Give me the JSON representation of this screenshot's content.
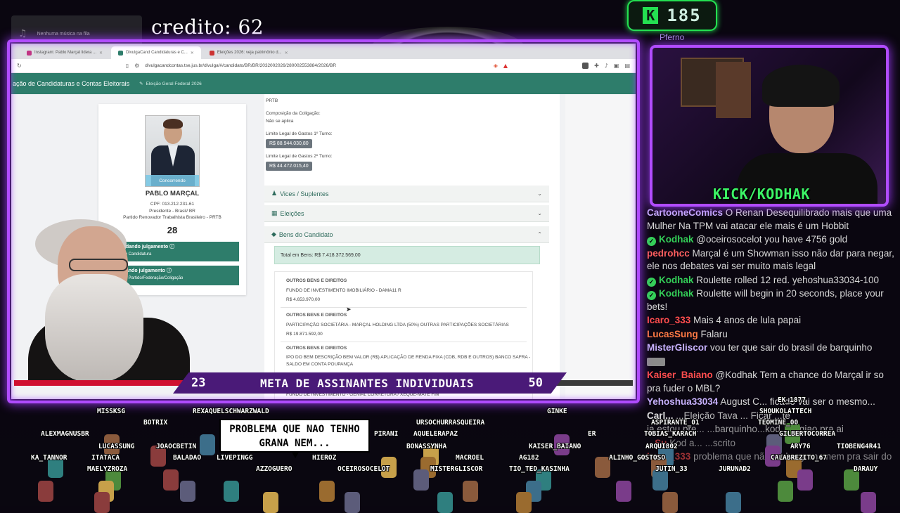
{
  "overlay": {
    "music_widget": "Nenhuma música na fila",
    "credit": "credito: 62",
    "kick_letter": "K",
    "kick_count": "185",
    "pfreno": "Pferno"
  },
  "browser": {
    "tabs": [
      {
        "label": "Instagram: Pablo Marçal lidera ..."
      },
      {
        "label": "DivulgaCand Candidaturas e C..."
      },
      {
        "label": "Eleições 2026: veja patrimônio d..."
      }
    ],
    "url": "divulgacandcontas.tse.jus.br/divulga/#/candidato/BR/BR/2032002026/280002553884/2026/BR",
    "site_title": "ação de Candidaturas e Contas Eleitorais",
    "site_subtitle": "Eleição Geral Federal 2026"
  },
  "candidate": {
    "status_badge": "Concorrendo",
    "name": "PABLO MARÇAL",
    "cpf": "CPF: 013.212.231-61",
    "role": "Presidente - Brasil/ BR",
    "party": "Partido Renovador Trabalhista Brasileiro - PRTB",
    "number": "28",
    "status_1_title": "uardando julgamento",
    "status_1_sub": "ação Candidatura",
    "status_2_title": "ardando julgamento",
    "status_2_sub": "ação Partido/Federação/Coligação"
  },
  "details": {
    "party_abbr": "PRTB",
    "coligacao_label": "Composição da Coligação:",
    "coligacao_value": "Não se aplica",
    "limit1_label": "Limite Legal de Gastos 1º Turno:",
    "limit1_value": "R$ 88.944.030,80",
    "limit2_label": "Limite Legal de Gastos 2º Turno:",
    "limit2_value": "R$ 44.472.015,40",
    "accordions": [
      "Vices / Suplentes",
      "Eleições",
      "Bens do Candidato"
    ],
    "total_label": "Total em Bens:",
    "total_value": "R$ 7.418.372.569,00",
    "assets": [
      {
        "category": "OUTROS BENS E DIREITOS",
        "desc": "FUNDO DE INVESTIMENTO IMOBILIÁRIO - DAMA11 R",
        "value": "R$ 4.653.970,00"
      },
      {
        "category": "OUTROS BENS E DIREITOS",
        "desc": "PARTICIPAÇÃO SOCIETÁRIA - MARÇAL HOLDING LTDA (50%) OUTRAS PARTICIPAÇÕES SOCIETÁRIAS",
        "value": "R$ 19.871.592,00"
      },
      {
        "category": "OUTROS BENS E DIREITOS",
        "desc": "IPO DO BEM DESCRIÇÃO BEM VALOR (R$) APLICAÇÃO DE RENDA FIXA (CDB, RDB E OUTROS) BANCO SAFRA - SALDO EM CONTA POUPANÇA",
        "value": ""
      },
      {
        "category": "",
        "desc": "FUNDO DE INVESTIMENTO - GENIAL CORRETORA / XEQUE-MATE FIM",
        "value": ""
      }
    ]
  },
  "cam": {
    "label": "KICK/KODHAK"
  },
  "chat": [
    {
      "user": "CartooneComics",
      "color": "#c9b3ff",
      "verified": false,
      "text": "O Renan Desequilibrado mais que uma Mulher Na TPM vai atacar ele mais é um Hobbit"
    },
    {
      "user": "Kodhak",
      "color": "#34d058",
      "verified": true,
      "text": "@oceirosocelot you have 4756 gold"
    },
    {
      "user": "pedrohcc",
      "color": "#ff5f5f",
      "verified": false,
      "text": "Marçal é um Showman isso não dar para negar, ele nos debates vai ser muito mais legal"
    },
    {
      "user": "Kodhak",
      "color": "#34d058",
      "verified": true,
      "text": "Roulette rolled 12 red. yehoshua33034-100"
    },
    {
      "user": "Kodhak",
      "color": "#34d058",
      "verified": true,
      "text": "Roulette will begin in 20 seconds, place your bets!"
    },
    {
      "user": "Icaro_333",
      "color": "#ff4d4d",
      "verified": false,
      "text": "Mais 4 anos de lula papai"
    },
    {
      "user": "LucasSung",
      "color": "#ff7a45",
      "verified": false,
      "text": "Falaru"
    },
    {
      "user": "MisterGliscor",
      "color": "#c9b3ff",
      "verified": false,
      "text": "vou ter que sair do brasil de barquinho"
    },
    {
      "user": "",
      "color": "#ffffff",
      "verified": false,
      "text": "",
      "emote": true
    },
    {
      "user": "Kaiser_Baiano",
      "color": "#ff4d4d",
      "verified": false,
      "text": "@Kodhak Tem a chance do Marçal ir so pra fuder o MBL?"
    },
    {
      "user": "Yehoshua33034",
      "color": "#c9b3ff",
      "verified": false,
      "text": "August C... ficado vai ser o mesmo..."
    },
    {
      "user": "Carl...",
      "color": "#ffffff",
      "verified": false,
      "text": "...Eleição Tava ... Ficar ...te"
    },
    {
      "user": "",
      "color": "#ffffff",
      "verified": false,
      "text": "ja estou pre... ...barquinho...kod ...regiao pra ai"
    },
    {
      "user": "...Su",
      "color": "#ff4d4d",
      "verified": false,
      "text": "Kod a... ...scrito"
    },
    {
      "user": "Icaro_333",
      "color": "#ff4d4d",
      "verified": false,
      "text": "problema que não tenho grana nem pra sair do"
    }
  ],
  "goal": {
    "current": "23",
    "label": "META DE ASSINANTES INDIVIDUAIS",
    "target": "50",
    "progress_fraction": 0.46
  },
  "crowd": {
    "speech": "PROBLEMA QUE NAO TENHO GRANA NEM...",
    "names": [
      "MISSKSG",
      "REXAQUELSCHWARZWALD",
      "GINKE",
      "EK_1877",
      "BOTRIX",
      "URSOCHURRASQUEIRA",
      "SHOUKOLATTECH",
      "ALEXMAGNUSBR",
      "AQUELERAPAZ",
      "ER",
      "ASPIRANTE_01",
      "TEOMINE_00",
      "LUCASSUNG",
      "JOAOCBETIN",
      "PIRANI",
      "BONASSYNHA",
      "KAISER_BAIANO",
      "GILBERTOCORREA",
      "TOBIAS_KARACH",
      "ARQUI802",
      "ARY76",
      "TIOBENG4R41",
      "KA_TANNOR",
      "ITATACA",
      "BALADAO",
      "LIVEPINGG",
      "HIEROZ",
      "MACROEL",
      "AG182",
      "ALINHO_GOSTOSO",
      "CALABREZITO_67",
      "MAELYZROZA",
      "AZZOGUERO",
      "OCEIROSOCELOT",
      "MISTERGLISCOR",
      "TIO_TED_KASINHA",
      "JUTIN_33",
      "JURUNAD2",
      "DARAUY"
    ]
  }
}
